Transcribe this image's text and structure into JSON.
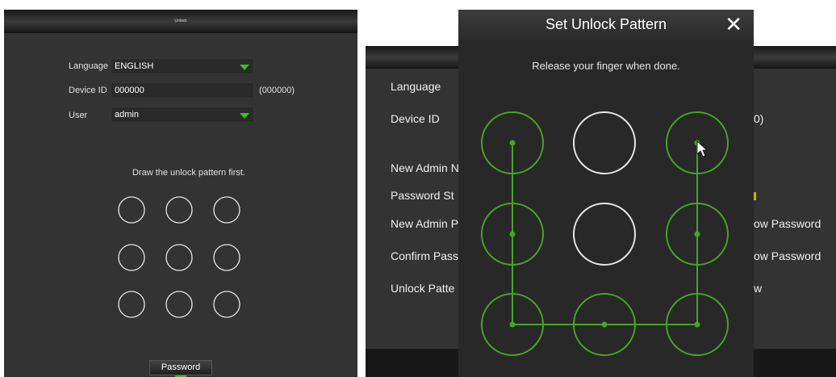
{
  "left": {
    "title": "Unlock",
    "language_label": "Language",
    "language_value": "ENGLISH",
    "device_id_label": "Device ID",
    "device_id_value": "000000",
    "device_id_hint": "(000000)",
    "user_label": "User",
    "user_value": "admin",
    "instruction": "Draw the unlock pattern first.",
    "password_button": "Password"
  },
  "right": {
    "background_labels": {
      "language": "Language",
      "device_id": "Device ID",
      "new_admin_name": "New Admin N",
      "password_strength": "Password St",
      "new_admin_password": "New Admin P",
      "confirm_password": "Confirm Pass",
      "unlock_pattern": "Unlock Patte",
      "device_id_suffix": "0)",
      "show_password_1": "ow Password",
      "show_password_2": "ow Password",
      "show_suffix": "w"
    },
    "modal": {
      "title": "Set Unlock Pattern",
      "close_glyph": "✕",
      "instruction": "Release your finger when done."
    }
  },
  "pattern": {
    "selected_nodes": [
      0,
      2,
      3,
      5,
      6,
      7,
      8
    ],
    "path": [
      2,
      5,
      8,
      7,
      6,
      3,
      0
    ],
    "active_color": "#45a526",
    "idle_color": "#e6e6e6"
  }
}
